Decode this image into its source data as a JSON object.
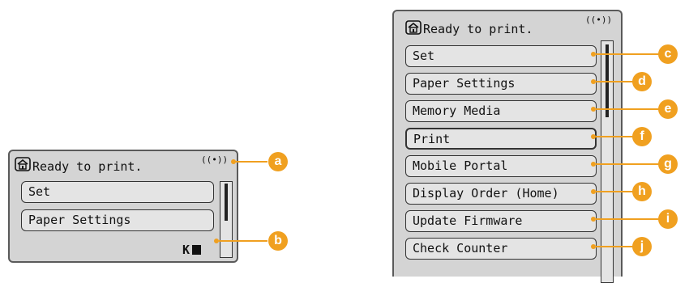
{
  "small_panel": {
    "status": "Ready to print.",
    "signal": "((•))",
    "menu": [
      "Set",
      "Paper Settings"
    ],
    "toner_label": "K"
  },
  "large_panel": {
    "status": "Ready to print.",
    "signal": "((•))",
    "menu": [
      "Set",
      "Paper Settings",
      "Memory Media",
      "Print",
      "Mobile Portal",
      "Display Order (Home)",
      "Update Firmware",
      "Check Counter"
    ]
  },
  "callouts": [
    "a",
    "b",
    "c",
    "d",
    "e",
    "f",
    "g",
    "h",
    "i",
    "j"
  ],
  "icons": {
    "home": "home-icon",
    "signal": "wireless-signal-icon",
    "toner": "toner-icon"
  },
  "colors": {
    "callout": "#f0a020",
    "lcd_background": "#d4d4d4"
  }
}
